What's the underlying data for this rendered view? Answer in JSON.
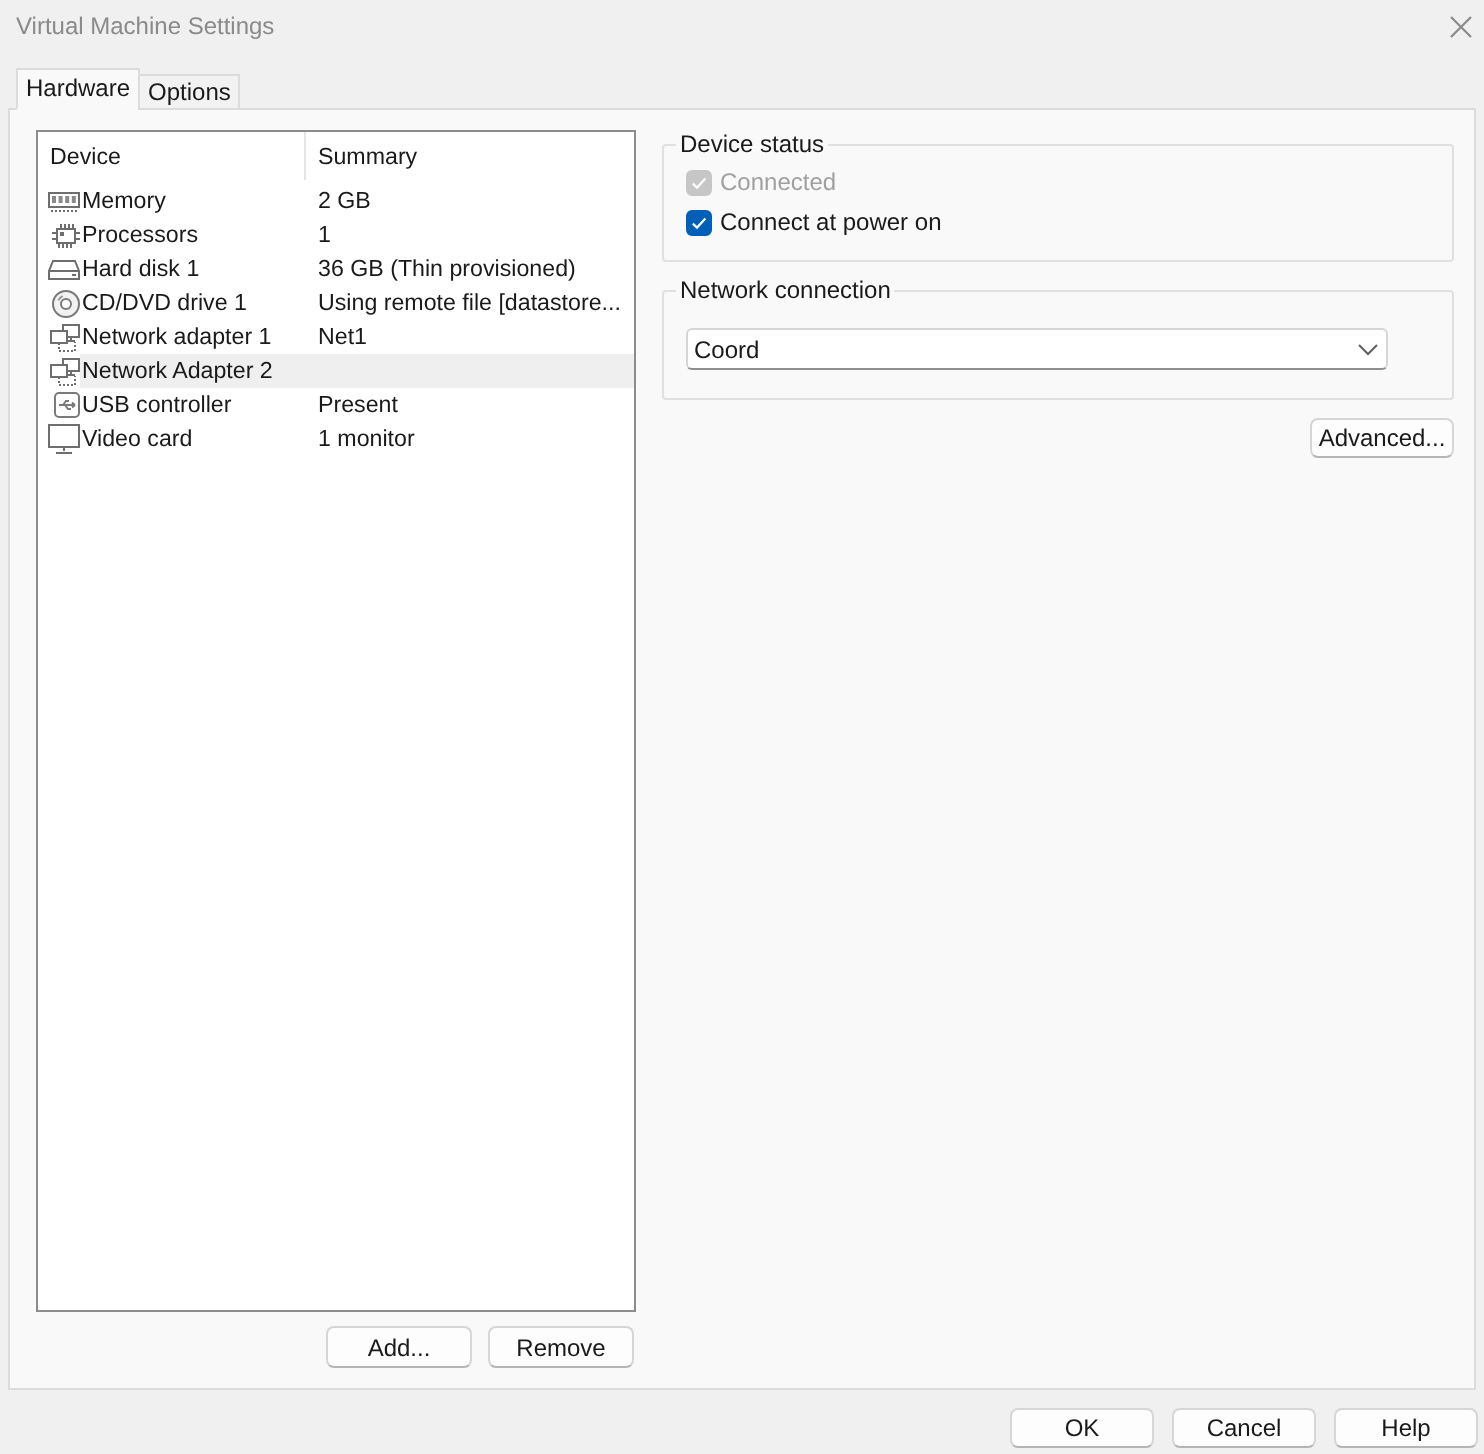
{
  "window": {
    "title": "Virtual Machine Settings"
  },
  "tabs": [
    {
      "label": "Hardware",
      "selected": true
    },
    {
      "label": "Options",
      "selected": false
    }
  ],
  "device_list": {
    "columns": [
      "Device",
      "Summary"
    ],
    "rows": [
      {
        "kind": "memory",
        "device": "Memory",
        "summary": "2 GB",
        "selected": false
      },
      {
        "kind": "processor",
        "device": "Processors",
        "summary": "1",
        "selected": false
      },
      {
        "kind": "disk",
        "device": "Hard disk 1",
        "summary": "36 GB (Thin provisioned)",
        "selected": false
      },
      {
        "kind": "cdrom",
        "device": "CD/DVD drive 1",
        "summary": "Using remote file [datastore...",
        "selected": false
      },
      {
        "kind": "network",
        "device": "Network adapter 1",
        "summary": "Net1",
        "selected": false
      },
      {
        "kind": "network",
        "device": "Network Adapter 2",
        "selected": true
      },
      {
        "kind": "usb",
        "device": "USB controller",
        "summary": "Present",
        "selected": false
      },
      {
        "kind": "display",
        "device": "Video card",
        "summary": "1 monitor",
        "selected": false
      }
    ],
    "buttons": [
      "Add...",
      "Remove"
    ]
  },
  "device_status": {
    "title": "Device status",
    "options": [
      {
        "label": "Connected",
        "checked": true,
        "disabled": true
      },
      {
        "label": "Connect at power on",
        "checked": true,
        "disabled": false
      }
    ]
  },
  "network_connection": {
    "title": "Network connection",
    "value": "Coord"
  },
  "advanced_button": "Advanced...",
  "dialog_buttons": [
    "OK",
    "Cancel",
    "Help"
  ]
}
